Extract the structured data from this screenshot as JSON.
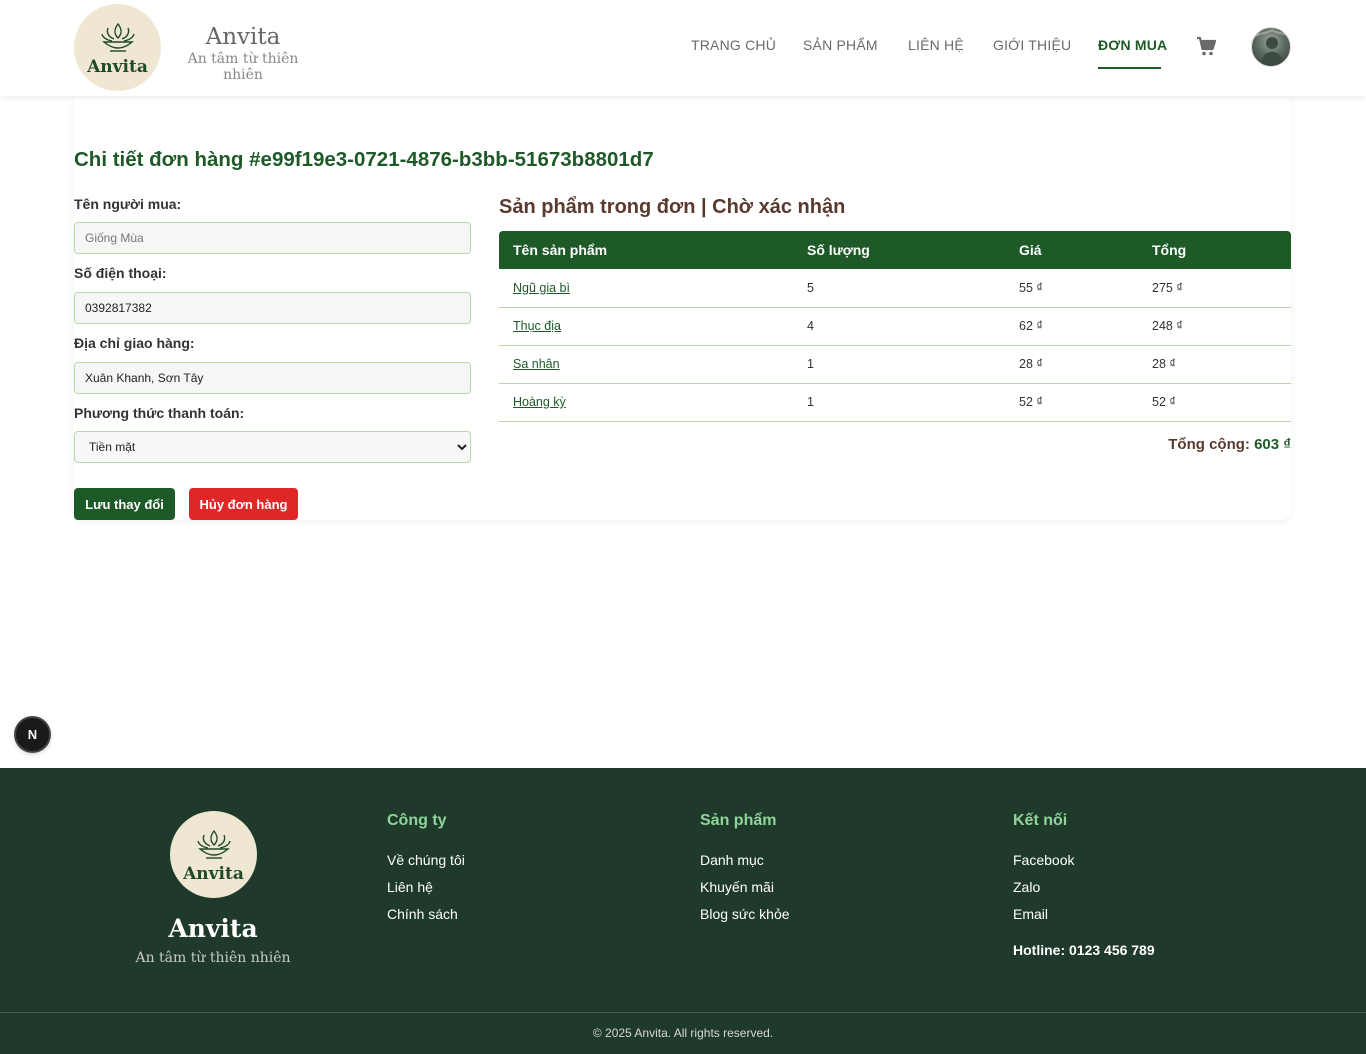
{
  "header": {
    "logo_text": "Anvita",
    "brand_name": "Anvita",
    "brand_tagline": "An tâm từ thiên nhiên",
    "nav": [
      "TRANG CHỦ",
      "SẢN PHẨM",
      "LIÊN HỆ",
      "GIỚI THIỆU",
      "ĐƠN MUA"
    ],
    "active_nav": "ĐƠN MUA",
    "cart_icon": "cart-icon",
    "avatar_icon": "user-avatar"
  },
  "order": {
    "title": "Chi tiết đơn hàng #e99f19e3-0721-4876-b3bb-51673b8801d7",
    "buyer_label": "Tên người mua:",
    "buyer_placeholder": "Giống Mùa",
    "phone_label": "Số điện thoại:",
    "phone_value": "0392817382",
    "address_label": "Địa chỉ giao hàng:",
    "address_value": "Xuân Khanh, Sơn Tây",
    "payment_label": "Phương thức thanh toán:",
    "payment_value": "Tiền mặt",
    "save_label": "Lưu thay đổi",
    "cancel_label": "Hủy đơn hàng"
  },
  "products": {
    "section_title": "Sản phẩm trong đơn | Chờ xác nhận",
    "headers": [
      "Tên sản phẩm",
      "Số lượng",
      "Giá",
      "Tổng"
    ],
    "rows": [
      {
        "name": "Ngũ gia bì",
        "qty": "5",
        "price": "55 ₫",
        "total": "275 ₫"
      },
      {
        "name": "Thục địa",
        "qty": "4",
        "price": "62 ₫",
        "total": "248 ₫"
      },
      {
        "name": "Sa nhân",
        "qty": "1",
        "price": "28 ₫",
        "total": "28 ₫"
      },
      {
        "name": "Hoàng kỳ",
        "qty": "1",
        "price": "52 ₫",
        "total": "52 ₫"
      }
    ],
    "total_label": "Tổng cộng:",
    "total_value": "603 ₫"
  },
  "dev_badge": "N",
  "footer": {
    "logo_text": "Anvita",
    "brand_name": "Anvita",
    "brand_tagline": "An tâm từ thiên nhiên",
    "company_title": "Công ty",
    "company_links": [
      "Về chúng tôi",
      "Liên hệ",
      "Chính sách"
    ],
    "product_title": "Sản phẩm",
    "product_links": [
      "Danh mục",
      "Khuyến mãi",
      "Blog sức khỏe"
    ],
    "connect_title": "Kết nối",
    "connect_links": [
      "Facebook",
      "Zalo",
      "Email"
    ],
    "hotline": "Hotline: 0123 456 789",
    "copyright": "© 2025 Anvita. All rights reserved."
  },
  "colors": {
    "primary_green": "#1e5a28",
    "footer_bg": "#1f3a2b",
    "cancel_red": "#e02727",
    "section_brown": "#5a3a2e"
  }
}
